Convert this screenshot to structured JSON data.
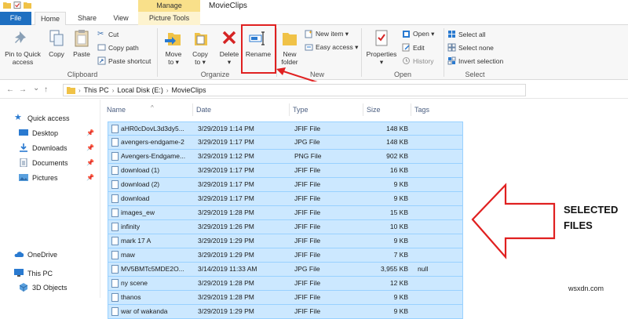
{
  "window": {
    "title": "MovieClips",
    "context_tab_header": "Manage"
  },
  "tabs": [
    {
      "label": "File"
    },
    {
      "label": "Home"
    },
    {
      "label": "Share"
    },
    {
      "label": "View"
    },
    {
      "label": "Picture Tools"
    }
  ],
  "ribbon": {
    "clipboard": {
      "pin": "Pin to Quick access",
      "pin_line1": "Pin to Quick",
      "pin_line2": "access",
      "copy": "Copy",
      "paste": "Paste",
      "cut": "Cut",
      "copy_path": "Copy path",
      "paste_shortcut": "Paste shortcut",
      "label": "Clipboard"
    },
    "organize": {
      "move_to_l1": "Move",
      "move_to_l2": "to ▾",
      "copy_to_l1": "Copy",
      "copy_to_l2": "to ▾",
      "delete": "Delete",
      "delete_arrow": "▾",
      "rename": "Rename",
      "label": "Organize"
    },
    "new": {
      "new_folder_l1": "New",
      "new_folder_l2": "folder",
      "new_item": "New item ▾",
      "easy_access": "Easy access ▾",
      "label": "New"
    },
    "open": {
      "properties": "Properties",
      "properties_arrow": "▾",
      "open": "Open ▾",
      "edit": "Edit",
      "history": "History",
      "label": "Open"
    },
    "select": {
      "select_all": "Select all",
      "select_none": "Select none",
      "invert": "Invert selection",
      "label": "Select"
    }
  },
  "address": {
    "crumbs": [
      "This PC",
      "Local Disk (E:)",
      "MovieClips"
    ],
    "sep": "›",
    "back": "←",
    "forward": "→",
    "dropdown": "⌄",
    "up": "↑"
  },
  "sidebar": {
    "quick_access": "Quick access",
    "items": [
      {
        "label": "Desktop"
      },
      {
        "label": "Downloads"
      },
      {
        "label": "Documents"
      },
      {
        "label": "Pictures"
      }
    ],
    "pin_glyph": "📌",
    "onedrive": "OneDrive",
    "this_pc": "This PC",
    "objects3d": "3D Objects"
  },
  "columns": {
    "name": "Name",
    "date": "Date",
    "type": "Type",
    "size": "Size",
    "tags": "Tags",
    "sort_caret": "^"
  },
  "files": [
    {
      "name": "aHR0cDovL3d3dy5...",
      "date": "3/29/2019 1:14 PM",
      "type": "JFIF File",
      "size": "148 KB",
      "tags": ""
    },
    {
      "name": "avengers-endgame-2",
      "date": "3/29/2019 1:17 PM",
      "type": "JPG File",
      "size": "148 KB",
      "tags": ""
    },
    {
      "name": "Avengers-Endgame...",
      "date": "3/29/2019 1:12 PM",
      "type": "PNG File",
      "size": "902 KB",
      "tags": ""
    },
    {
      "name": "download (1)",
      "date": "3/29/2019 1:17 PM",
      "type": "JFIF File",
      "size": "16 KB",
      "tags": ""
    },
    {
      "name": "download (2)",
      "date": "3/29/2019 1:17 PM",
      "type": "JFIF File",
      "size": "9 KB",
      "tags": ""
    },
    {
      "name": "download",
      "date": "3/29/2019 1:17 PM",
      "type": "JFIF File",
      "size": "9 KB",
      "tags": ""
    },
    {
      "name": "images_ew",
      "date": "3/29/2019 1:28 PM",
      "type": "JFIF File",
      "size": "15 KB",
      "tags": ""
    },
    {
      "name": "infinity",
      "date": "3/29/2019 1:26 PM",
      "type": "JFIF File",
      "size": "10 KB",
      "tags": ""
    },
    {
      "name": "mark 17 A",
      "date": "3/29/2019 1:29 PM",
      "type": "JFIF File",
      "size": "9 KB",
      "tags": ""
    },
    {
      "name": "maw",
      "date": "3/29/2019 1:29 PM",
      "type": "JFIF File",
      "size": "7 KB",
      "tags": ""
    },
    {
      "name": "MV5BMTc5MDE2O...",
      "date": "3/14/2019 11:33 AM",
      "type": "JPG File",
      "size": "3,955 KB",
      "tags": "null"
    },
    {
      "name": "ny scene",
      "date": "3/29/2019 1:28 PM",
      "type": "JFIF File",
      "size": "12 KB",
      "tags": ""
    },
    {
      "name": "thanos",
      "date": "3/29/2019 1:28 PM",
      "type": "JFIF File",
      "size": "9 KB",
      "tags": ""
    },
    {
      "name": "war of wakanda",
      "date": "3/29/2019 1:29 PM",
      "type": "JFIF File",
      "size": "9 KB",
      "tags": ""
    }
  ],
  "annotation": {
    "line1": "SELECTED",
    "line2": "FILES"
  },
  "watermark": "wsxdn.com",
  "colors": {
    "selection_bg": "#cce8ff",
    "selection_border": "#99d1ff",
    "highlight_red": "#e02020",
    "file_tab": "#1e6fc1",
    "manage_tab": "#f9e08a"
  }
}
